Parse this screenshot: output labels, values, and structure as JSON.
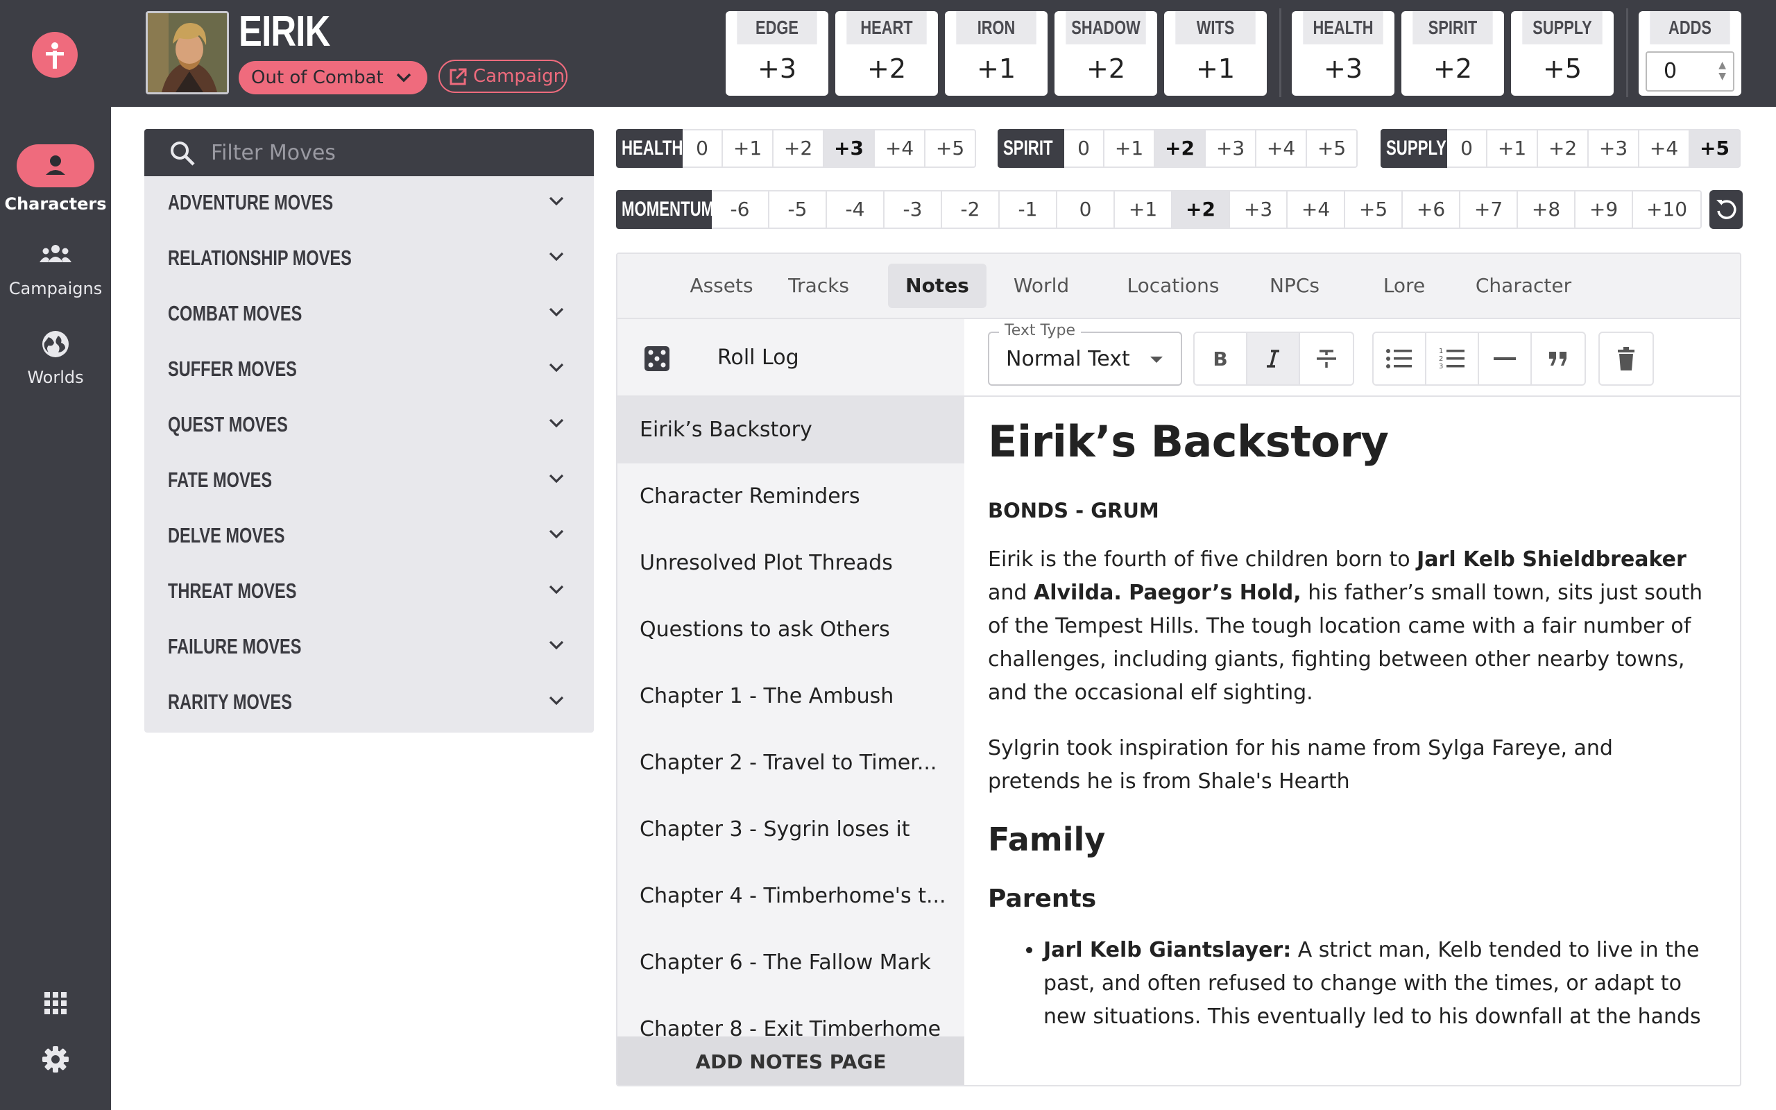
{
  "rail": {
    "items": [
      {
        "label": "Characters",
        "icon": "person-icon",
        "active": true
      },
      {
        "label": "Campaigns",
        "icon": "group-icon",
        "active": false
      },
      {
        "label": "Worlds",
        "icon": "globe-icon",
        "active": false
      }
    ]
  },
  "header": {
    "name": "EIRIK",
    "combat_state": "Out of Combat",
    "campaign_label": "Campaign",
    "stats": [
      {
        "label": "EDGE",
        "value": "+3"
      },
      {
        "label": "HEART",
        "value": "+2"
      },
      {
        "label": "IRON",
        "value": "+1"
      },
      {
        "label": "SHADOW",
        "value": "+2"
      },
      {
        "label": "WITS",
        "value": "+1"
      }
    ],
    "meters": [
      {
        "label": "HEALTH",
        "value": "+3"
      },
      {
        "label": "SPIRIT",
        "value": "+2"
      },
      {
        "label": "SUPPLY",
        "value": "+5"
      }
    ],
    "adds": {
      "label": "ADDS",
      "value": "0"
    }
  },
  "moves": {
    "filter_placeholder": "Filter Moves",
    "categories": [
      "ADVENTURE MOVES",
      "RELATIONSHIP MOVES",
      "COMBAT MOVES",
      "SUFFER MOVES",
      "QUEST MOVES",
      "FATE MOVES",
      "DELVE MOVES",
      "THREAT MOVES",
      "FAILURE MOVES",
      "RARITY MOVES"
    ]
  },
  "tracks": {
    "health": {
      "label": "HEALTH",
      "options": [
        "0",
        "+1",
        "+2",
        "+3",
        "+4",
        "+5"
      ],
      "selected": "+3"
    },
    "spirit": {
      "label": "SPIRIT",
      "options": [
        "0",
        "+1",
        "+2",
        "+3",
        "+4",
        "+5"
      ],
      "selected": "+2"
    },
    "supply": {
      "label": "SUPPLY",
      "options": [
        "0",
        "+1",
        "+2",
        "+3",
        "+4",
        "+5"
      ],
      "selected": "+5"
    },
    "momentum": {
      "label": "MOMENTUM",
      "options": [
        "-6",
        "-5",
        "-4",
        "-3",
        "-2",
        "-1",
        "0",
        "+1",
        "+2",
        "+3",
        "+4",
        "+5",
        "+6",
        "+7",
        "+8",
        "+9",
        "+10"
      ],
      "selected": "+2"
    }
  },
  "tabs": [
    "Assets",
    "Tracks",
    "Notes",
    "World",
    "Locations",
    "NPCs",
    "Lore",
    "Character"
  ],
  "active_tab": "Notes",
  "notes": {
    "roll_log": "Roll Log",
    "pages": [
      "Eirik’s Backstory",
      "Character Reminders",
      "Unresolved Plot Threads",
      "Questions to ask Others",
      "Chapter 1 - The Ambush",
      "Chapter 2 - Travel to Timer...",
      "Chapter 3 - Sygrin loses it",
      "Chapter 4 - Timberhome's t...",
      "Chapter 6 - The Fallow Mark",
      "Chapter 8 - Exit Timberhome"
    ],
    "add_label": "ADD NOTES PAGE"
  },
  "editor": {
    "text_type_label": "Text Type",
    "text_type_value": "Normal Text"
  },
  "doc": {
    "title": "Eirik’s Backstory",
    "bonds_heading": "BONDS - GRUM",
    "p1_a": "Eirik is the fourth of five children born to ",
    "p1_b": "Jarl Kelb Shieldbreaker",
    "p1_c": " and ",
    "p1_d": "Alvilda. Paegor’s Hold,",
    "p1_e": " his father’s small town, sits just south of the Tempest Hills. The tough location came with a fair number of challenges, including giants, fighting between other nearby towns, and the occasional elf sighting.",
    "p2": "Sylgrin took inspiration for his name from Sylga Fareye, and pretends he is from Shale's Hearth",
    "family": "Family",
    "parents": "Parents",
    "bullet_name": "Jarl Kelb Giantslayer:",
    "bullet_text": " A strict man, Kelb tended to live in the past, and often refused to change with the times, or adapt to new situations. This eventually led to his downfall at the hands"
  }
}
